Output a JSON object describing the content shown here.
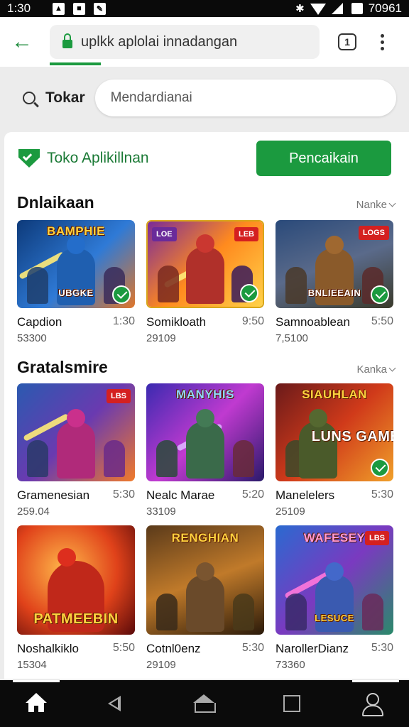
{
  "status": {
    "time": "1:30",
    "right_text": "70961"
  },
  "browser": {
    "url": "uplkk aplolai innadangan"
  },
  "search": {
    "label": "Tokar",
    "placeholder": "Mendardianai"
  },
  "store": {
    "title": "Toko Aplikillnan",
    "cta_label": "Pencaikain"
  },
  "sections": [
    {
      "title": "Dnlaikaan",
      "more_label": "Nanke",
      "items": [
        {
          "name": "Capdion",
          "price": "1:30",
          "downloads": "53300",
          "banner": "BAMPHIE",
          "caption": "UBGKE",
          "tag": "",
          "theme": "blue"
        },
        {
          "name": "Somikloath",
          "price": "9:50",
          "downloads": "29109",
          "banner": "",
          "caption": "",
          "tag": "LEB",
          "tag_left": "LOE",
          "theme": "fire"
        },
        {
          "name": "Samnoablean",
          "price": "5:50",
          "downloads": "7,5100",
          "banner": "",
          "caption": "BNLIEEAIN",
          "tag": "LOGS",
          "theme": "dusk"
        }
      ]
    },
    {
      "title": "Gratalsmire",
      "more_label": "Kanka",
      "items": [
        {
          "name": "Gramenesian",
          "price": "5:30",
          "downloads": "259.04",
          "banner": "",
          "caption": "",
          "tag": "LBS",
          "theme": "violet"
        },
        {
          "name": "Nealc Marae",
          "price": "5:20",
          "downloads": "33109",
          "banner": "MANYHIS",
          "caption": "",
          "tag": "",
          "theme": "storm"
        },
        {
          "name": "Manelelers",
          "price": "5:30",
          "downloads": "25109",
          "banner": "SIAUHLAN",
          "caption": "LUNS GAME",
          "tag": "",
          "theme": "red"
        }
      ]
    },
    {
      "title": "",
      "more_label": "",
      "items": [
        {
          "name": "Noshalkiklo",
          "price": "5:50",
          "downloads": "15304",
          "banner": "",
          "caption": "PATMEEBIN",
          "tag": "",
          "theme": "toon"
        },
        {
          "name": "Cotnl0enz",
          "price": "5:30",
          "downloads": "29109",
          "banner": "RENGHIAN",
          "caption": "",
          "tag": "",
          "theme": "sepia"
        },
        {
          "name": "NarollerDianz",
          "price": "5:30",
          "downloads": "73360",
          "banner": "WAFESEY",
          "caption": "LESUCE",
          "tag": "LBS",
          "theme": "neon"
        }
      ]
    }
  ],
  "colors": {
    "accent": "#1b9a3f",
    "accent_text": "#1b7a36"
  }
}
